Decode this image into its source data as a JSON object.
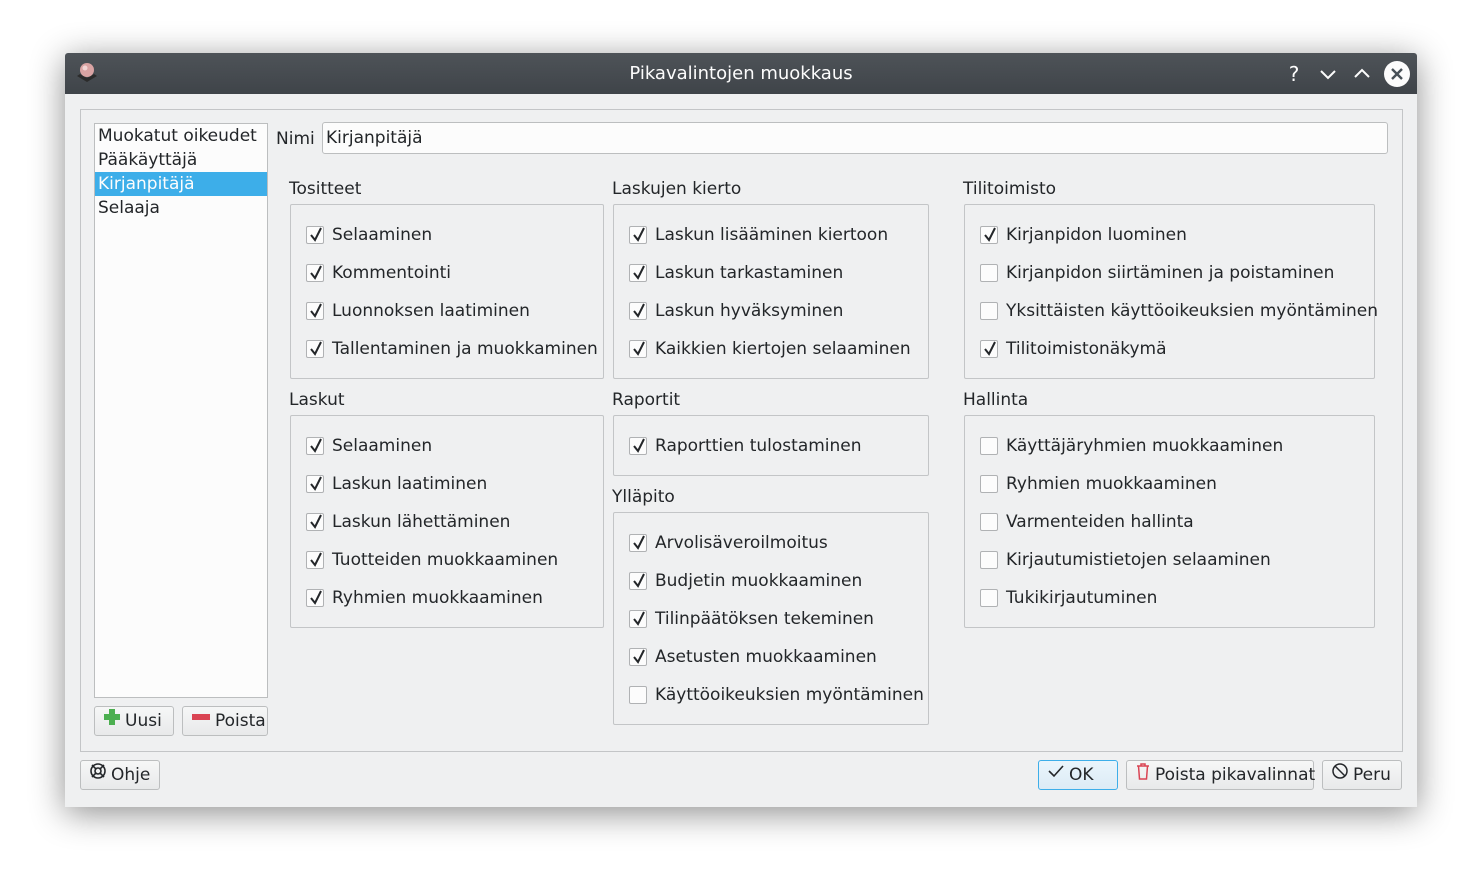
{
  "window": {
    "title": "Pikavalintojen muokkaus",
    "controls": [
      "?",
      "chevron-down",
      "chevron-up",
      "close"
    ]
  },
  "presets": {
    "items": [
      "Muokatut oikeudet",
      "Pääkäyttäjä",
      "Kirjanpitäjä",
      "Selaaja"
    ],
    "selected_index": 2,
    "new_label": "Uusi",
    "delete_label": "Poista"
  },
  "name": {
    "label": "Nimi",
    "value": "Kirjanpitäjä"
  },
  "groups": {
    "tositteet": {
      "title": "Tositteet",
      "items": [
        {
          "label": "Selaaminen",
          "checked": true
        },
        {
          "label": "Kommentointi",
          "checked": true
        },
        {
          "label": "Luonnoksen laatiminen",
          "checked": true
        },
        {
          "label": "Tallentaminen ja muokkaminen",
          "checked": true
        }
      ]
    },
    "laskut": {
      "title": "Laskut",
      "items": [
        {
          "label": "Selaaminen",
          "checked": true
        },
        {
          "label": "Laskun laatiminen",
          "checked": true
        },
        {
          "label": "Laskun lähettäminen",
          "checked": true
        },
        {
          "label": "Tuotteiden muokkaaminen",
          "checked": true
        },
        {
          "label": "Ryhmien muokkaaminen",
          "checked": true
        }
      ]
    },
    "laskujen_kierto": {
      "title": "Laskujen kierto",
      "items": [
        {
          "label": "Laskun lisääminen kiertoon",
          "checked": true
        },
        {
          "label": "Laskun tarkastaminen",
          "checked": true
        },
        {
          "label": "Laskun hyväksyminen",
          "checked": true
        },
        {
          "label": "Kaikkien kiertojen selaaminen",
          "checked": true
        }
      ]
    },
    "raportit": {
      "title": "Raportit",
      "items": [
        {
          "label": "Raporttien tulostaminen",
          "checked": true
        }
      ]
    },
    "yllapito": {
      "title": "Ylläpito",
      "items": [
        {
          "label": "Arvolisäveroilmoitus",
          "checked": true
        },
        {
          "label": "Budjetin muokkaaminen",
          "checked": true
        },
        {
          "label": "Tilinpäätöksen tekeminen",
          "checked": true
        },
        {
          "label": "Asetusten muokkaaminen",
          "checked": true
        },
        {
          "label": "Käyttöoikeuksien myöntäminen",
          "checked": false
        }
      ]
    },
    "tilitoimisto": {
      "title": "Tilitoimisto",
      "items": [
        {
          "label": "Kirjanpidon luominen",
          "checked": true
        },
        {
          "label": "Kirjanpidon siirtäminen ja poistaminen",
          "checked": false
        },
        {
          "label": "Yksittäisten käyttöoikeuksien myöntäminen",
          "checked": false
        },
        {
          "label": "Tilitoimistonäkymä",
          "checked": true
        }
      ]
    },
    "hallinta": {
      "title": "Hallinta",
      "items": [
        {
          "label": "Käyttäjäryhmien muokkaaminen",
          "checked": false
        },
        {
          "label": "Ryhmien muokkaaminen",
          "checked": false
        },
        {
          "label": "Varmenteiden hallinta",
          "checked": false
        },
        {
          "label": "Kirjautumistietojen selaaminen",
          "checked": false
        },
        {
          "label": "Tukikirjautuminen",
          "checked": false
        }
      ]
    }
  },
  "footer": {
    "help_label": "Ohje",
    "ok_label": "OK",
    "delete_presets_label": "Poista pikavalinnat",
    "cancel_label": "Peru"
  },
  "colors": {
    "selection": "#3daee9",
    "titlebar": "#475057",
    "window_bg": "#eff0f1",
    "new_icon": "#4caf50",
    "delete_icon": "#da4453"
  }
}
